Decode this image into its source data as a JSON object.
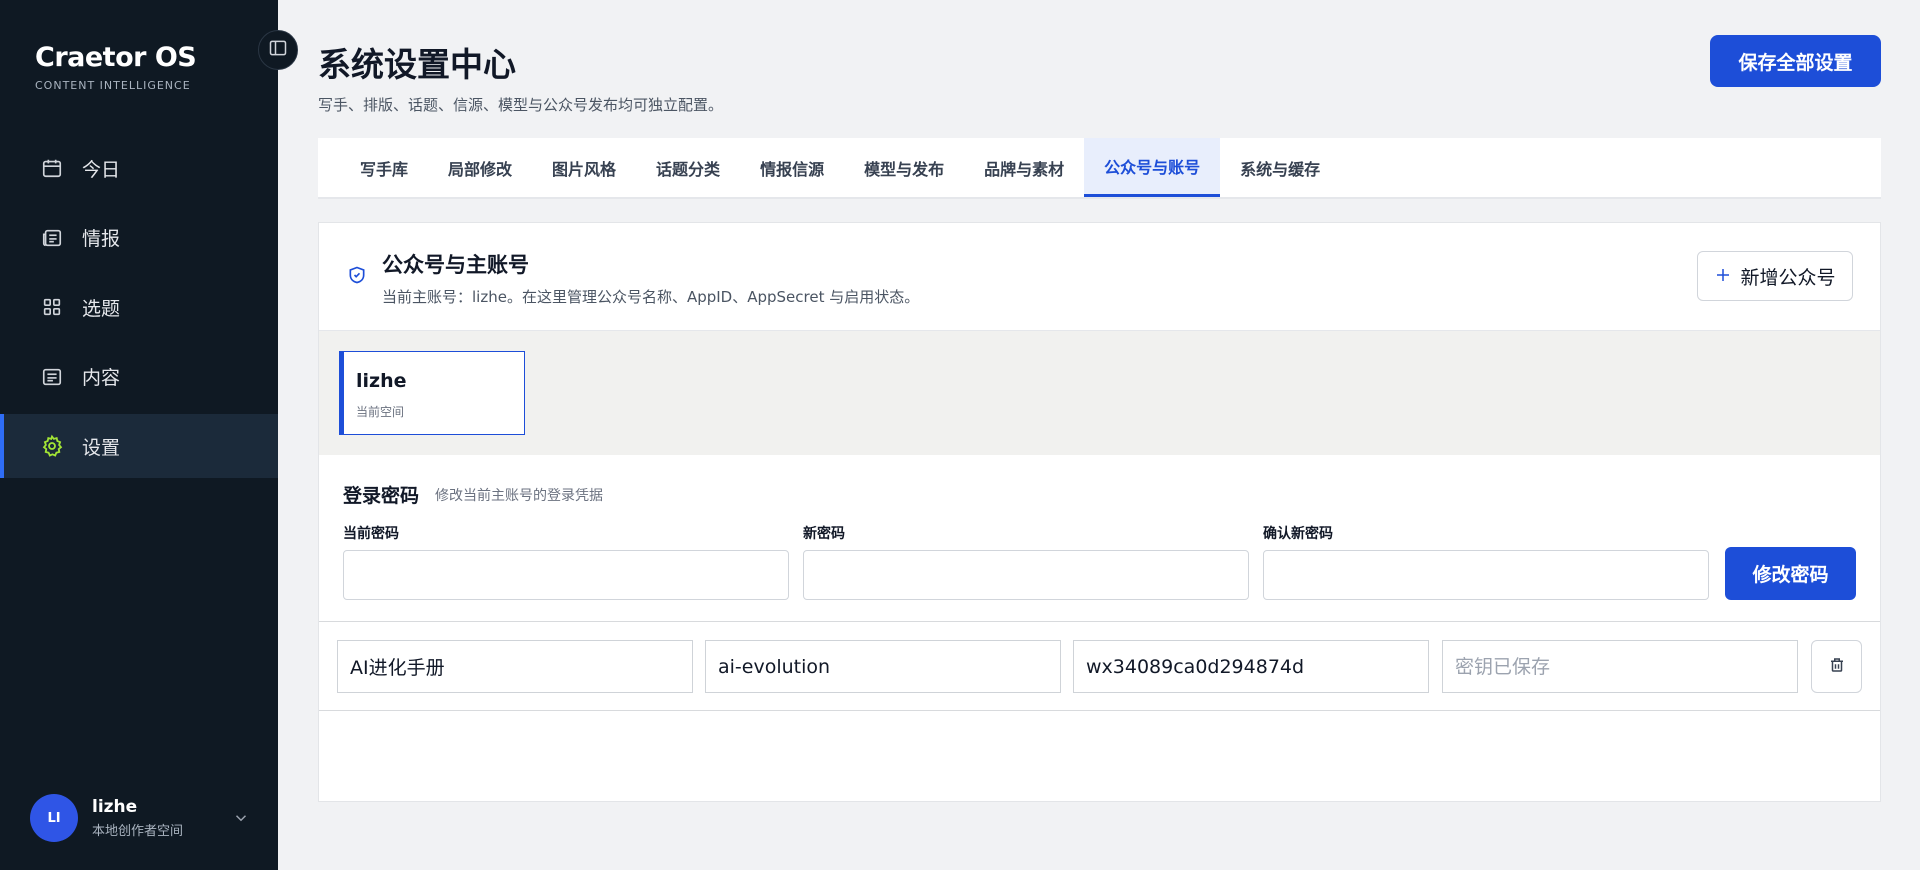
{
  "brand": {
    "title": "Craetor OS",
    "subtitle": "CONTENT INTELLIGENCE"
  },
  "sidebar": {
    "items": [
      {
        "label": "今日",
        "icon": "calendar-icon"
      },
      {
        "label": "情报",
        "icon": "newspaper-icon"
      },
      {
        "label": "选题",
        "icon": "grid-icon"
      },
      {
        "label": "内容",
        "icon": "document-icon"
      },
      {
        "label": "设置",
        "icon": "gear-icon",
        "active": true
      }
    ],
    "user": {
      "initials": "LI",
      "name": "lizhe",
      "subtitle": "本地创作者空间"
    }
  },
  "header": {
    "title": "系统设置中心",
    "subtitle": "写手、排版、话题、信源、模型与公众号发布均可独立配置。",
    "save_all_label": "保存全部设置"
  },
  "tabs": [
    {
      "label": "写手库"
    },
    {
      "label": "局部修改"
    },
    {
      "label": "图片风格"
    },
    {
      "label": "话题分类"
    },
    {
      "label": "情报信源"
    },
    {
      "label": "模型与发布"
    },
    {
      "label": "品牌与素材"
    },
    {
      "label": "公众号与账号",
      "active": true
    },
    {
      "label": "系统与缓存"
    }
  ],
  "panel": {
    "title": "公众号与主账号",
    "subtitle": "当前主账号：lizhe。在这里管理公众号名称、AppID、AppSecret 与启用状态。",
    "add_label": "新增公众号",
    "account": {
      "name": "lizhe",
      "subtitle": "当前空间"
    },
    "password": {
      "title": "登录密码",
      "subtitle": "修改当前主账号的登录凭据",
      "current_label": "当前密码",
      "new_label": "新密码",
      "confirm_label": "确认新密码",
      "button_label": "修改密码"
    },
    "official_account": {
      "name": "AI进化手册",
      "slug": "ai-evolution",
      "app_id": "wx34089ca0d294874d",
      "secret_placeholder": "密钥已保存"
    }
  },
  "colors": {
    "accent": "#1d4ed8",
    "sidebar_bg": "#0f1923",
    "active_icon": "#a3e635"
  }
}
